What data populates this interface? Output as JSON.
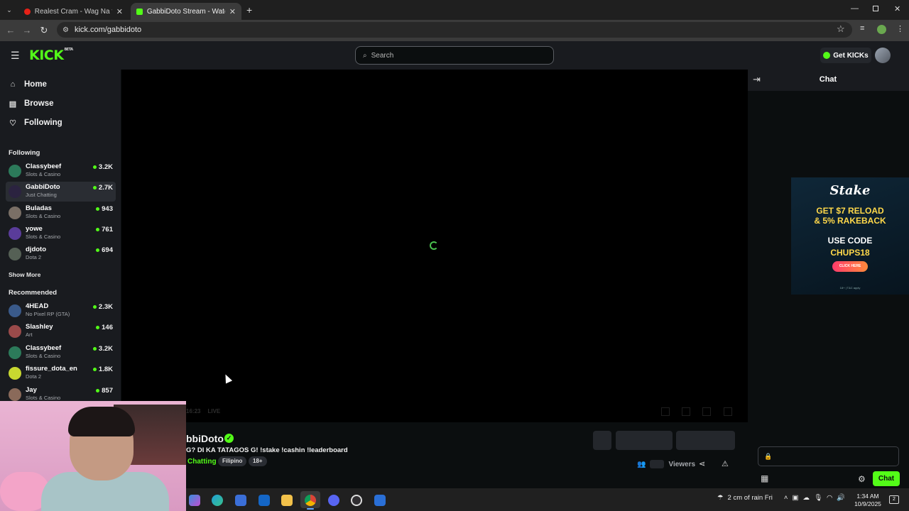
{
  "browser": {
    "tabs": [
      {
        "title": "Realest Cram - Wag Na feat. Cl",
        "active": false
      },
      {
        "title": "GabbiDoto Stream - Watch Live",
        "active": true
      }
    ],
    "url": "kick.com/gabbidoto",
    "new_tab": "+"
  },
  "header": {
    "logo": "KICK",
    "logo_badge": "BETA",
    "search_placeholder": "Search",
    "get_kicks": "Get KICKs"
  },
  "sidebar": {
    "nav": [
      {
        "label": "Home",
        "icon": "home-icon"
      },
      {
        "label": "Browse",
        "icon": "browse-icon"
      },
      {
        "label": "Following",
        "icon": "heart-icon"
      }
    ],
    "following_title": "Following",
    "following": [
      {
        "name": "Classybeef",
        "category": "Slots & Casino",
        "viewers": "3.2K",
        "color": "#2c7a5a"
      },
      {
        "name": "GabbiDoto",
        "category": "Just Chatting",
        "viewers": "2.7K",
        "color": "#2b2340"
      },
      {
        "name": "Buladas",
        "category": "Slots & Casino",
        "viewers": "943",
        "color": "#7a6f66"
      },
      {
        "name": "yowe",
        "category": "Slots & Casino",
        "viewers": "761",
        "color": "#5a3c9a"
      },
      {
        "name": "djdoto",
        "category": "Dota 2",
        "viewers": "694",
        "color": "#556055"
      }
    ],
    "show_more": "Show More",
    "recommended_title": "Recommended",
    "recommended": [
      {
        "name": "4HEAD",
        "category": "No Pixel RP (GTA)",
        "viewers": "2.3K",
        "color": "#3a5a8a"
      },
      {
        "name": "Slashley",
        "category": "Art",
        "viewers": "146",
        "color": "#9a4a4a"
      },
      {
        "name": "Classybeef",
        "category": "Slots & Casino",
        "viewers": "3.2K",
        "color": "#2c7a5a"
      },
      {
        "name": "fissure_dota_en",
        "category": "Dota 2",
        "viewers": "1.8K",
        "color": "#c8d830"
      },
      {
        "name": "Jay",
        "category": "Slots & Casino",
        "viewers": "857",
        "color": "#8a6a5a"
      }
    ]
  },
  "player": {
    "time": "16:23",
    "live": "LIVE"
  },
  "stream": {
    "streamer": "bbiDoto",
    "title": "G? DI KA TATAGOS G! !stake !cashin !leaderboard",
    "category": "Chatting",
    "tags": [
      "Filipino",
      "18+"
    ],
    "viewers_label": "Viewers"
  },
  "chat": {
    "title": "Chat",
    "send_label": "Chat",
    "ad": {
      "brand": "Stake",
      "line1": "GET $7 RELOAD",
      "line2": "& 5% RAKEBACK",
      "line3": "USE CODE",
      "line4": "CHUPS18",
      "cta": "CLICK HERE",
      "fine": "18+ | T&C apply"
    }
  },
  "taskbar": {
    "weather": "2 cm of rain Fri",
    "time": "1:34 AM",
    "date": "10/9/2025",
    "notifications": "2"
  }
}
